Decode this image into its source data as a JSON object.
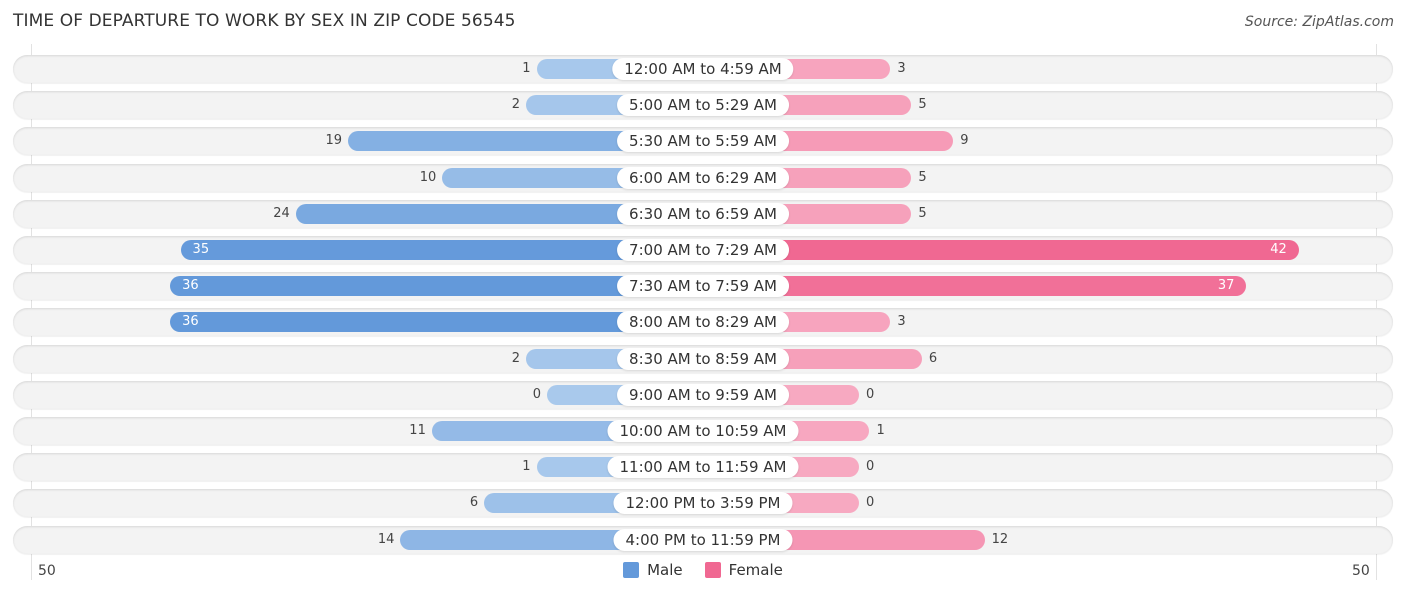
{
  "title": "TIME OF DEPARTURE TO WORK BY SEX IN ZIP CODE 56545",
  "source": "Source: ZipAtlas.com",
  "colors": {
    "male_light": "#a9c9ec",
    "male_dark": "#6399da",
    "female_light": "#f7a9c1",
    "female_dark": "#f06892"
  },
  "chart_data": {
    "type": "bar",
    "orientation": "horizontal-diverging",
    "title": "TIME OF DEPARTURE TO WORK BY SEX IN ZIP CODE 56545",
    "categories": [
      "12:00 AM to 4:59 AM",
      "5:00 AM to 5:29 AM",
      "5:30 AM to 5:59 AM",
      "6:00 AM to 6:29 AM",
      "6:30 AM to 6:59 AM",
      "7:00 AM to 7:29 AM",
      "7:30 AM to 7:59 AM",
      "8:00 AM to 8:29 AM",
      "8:30 AM to 8:59 AM",
      "9:00 AM to 9:59 AM",
      "10:00 AM to 10:59 AM",
      "11:00 AM to 11:59 AM",
      "12:00 PM to 3:59 PM",
      "4:00 PM to 11:59 PM"
    ],
    "series": [
      {
        "name": "Male",
        "values": [
          1,
          2,
          19,
          10,
          24,
          35,
          36,
          36,
          2,
          0,
          11,
          1,
          6,
          14
        ]
      },
      {
        "name": "Female",
        "values": [
          3,
          5,
          9,
          5,
          5,
          42,
          37,
          3,
          6,
          0,
          1,
          0,
          0,
          12
        ]
      }
    ],
    "axis": {
      "left_label": "50",
      "right_label": "50",
      "range": [
        -50,
        50
      ]
    },
    "legend": {
      "position": "bottom-center",
      "entries": [
        "Male",
        "Female"
      ]
    }
  }
}
